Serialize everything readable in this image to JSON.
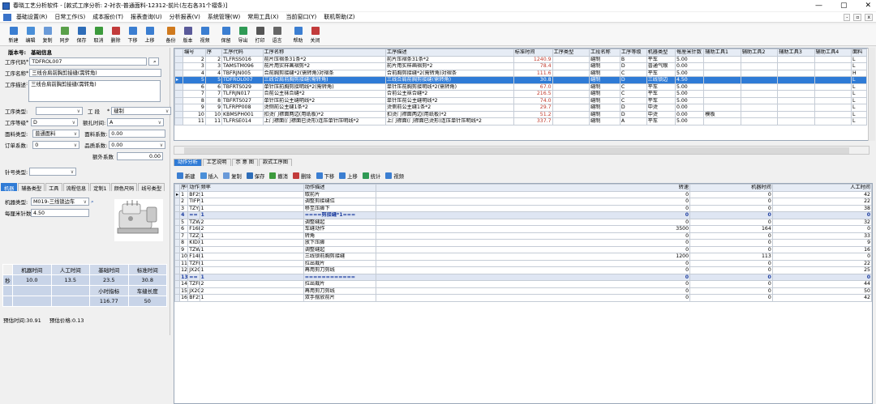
{
  "window": {
    "title": "春晓工艺分析软件 - [款式工序分析: 2-衬衣-普通面料-12312-前片(左右各31个褶条)]"
  },
  "menu": [
    "基础设置(R)",
    "日常工作(S)",
    "成本报价(T)",
    "报表查询(U)",
    "分析报表(V)",
    "系统管理(W)",
    "常用工具(X)",
    "当前窗口(Y)",
    "联机帮助(Z)"
  ],
  "toolbar": [
    {
      "label": "新建",
      "color": "#3b7ed1"
    },
    {
      "label": "编辑",
      "color": "#4a8fd8"
    },
    {
      "label": "复制",
      "color": "#6a9ad8"
    },
    {
      "label": "同步",
      "color": "#5aa04a"
    },
    {
      "label": "保存",
      "color": "#2e6db8"
    },
    {
      "label": "取消",
      "color": "#3c9a3c"
    },
    {
      "label": "删除",
      "color": "#c23b3b"
    },
    {
      "label": "下移",
      "color": "#3b7ed1"
    },
    {
      "label": "上移",
      "color": "#3b7ed1"
    },
    {
      "label": "备份",
      "color": "#d07a1e"
    },
    {
      "label": "版本",
      "color": "#5a5a9a"
    },
    {
      "label": "视频",
      "color": "#3b7ed1"
    },
    {
      "label": "保留",
      "color": "#3b7ed1"
    },
    {
      "label": "导出",
      "color": "#2f9a55"
    },
    {
      "label": "打印",
      "color": "#555555"
    },
    {
      "label": "语言",
      "color": "#666666"
    },
    {
      "label": "帮助",
      "color": "#3b7ed1"
    },
    {
      "label": "关闭",
      "color": "#c23b3b"
    }
  ],
  "left": {
    "version_label": "版本号:",
    "basic_info_label": "基础信息",
    "code_label": "工序代码",
    "code_value": "TDFROL007",
    "name_label": "工序名称",
    "name_value": "三线合肩前胸剪接缝(需转角)",
    "desc_label": "工序描述",
    "desc_value": "三线合肩前胸剪接缝(需转角)",
    "type_label": "工序类型:",
    "type_value": "",
    "section_label": "工  段",
    "section_value": "缝制",
    "grade_label": "工序等级",
    "grade_value": "D",
    "shortening_label": "额扎时间:",
    "shortening_value": "A",
    "fabric_label": "面料类型:",
    "fabric_value": "普通面料",
    "fabric_coef_label": "面料系数:",
    "fabric_coef_value": "0.00",
    "order_label": "订单系数:",
    "order_value": "0",
    "quality_label": "品质系数:",
    "quality_value": "0.00",
    "extra_label": "额外系数",
    "extra_value": "0.00",
    "needle_label": "针号类型:",
    "needle_value": ""
  },
  "lower_tabs": [
    "机器",
    "辅备类型",
    "工具",
    "流程信息",
    "定制1",
    "颜色尺码",
    "线号类型"
  ],
  "machine": {
    "type_label": "机器类型:",
    "type_value": "M019-三线锁边车",
    "stitch_label": "每厘米针数",
    "stitch_value": "4.50"
  },
  "stats": {
    "h1": "机器时间",
    "h2": "人工时间",
    "h3": "基础时间",
    "h4": "标准时间",
    "unit": "秒",
    "v1": "10.0",
    "v2": "13.5",
    "v3": "23.5",
    "v4": "30.8",
    "h5": "小时指标",
    "h6": "车缝长度",
    "v5": "116.77",
    "v6": "50"
  },
  "footer": {
    "time": "预估时间:30.91",
    "price": "预估价格:0.13"
  },
  "grid1": {
    "headers": [
      "编号",
      "序",
      "工序代码",
      "工序名称",
      "工序描述",
      "标准时间",
      "工序类型",
      "工段名称",
      "工序等级",
      "机器类型",
      "每厘米针数",
      "辅助工具1",
      "辅助工具2",
      "辅助工具3",
      "辅助工具4",
      "面料"
    ],
    "rows": [
      [
        "2",
        "2",
        "TLFRSS016",
        "前片压褶条31条*2",
        "前片压褶条31条*2",
        "1240.9",
        "",
        "缝制",
        "B",
        "平车",
        "5.00",
        "",
        "",
        "",
        "",
        "L"
      ],
      [
        "3",
        "3",
        "TAMSTM096",
        "前片用实样画褶剪*2",
        "前片用实样画褶剪*2",
        "78.4",
        "",
        "缝制",
        "D",
        "普通气眼",
        "0.00",
        "",
        "",
        "",
        "",
        "L"
      ],
      [
        "4",
        "4",
        "TBFRJN005",
        "合前胸剪接缝*2(需转角)对褶条",
        "合前胸剪接缝*2(需转角)对褶条",
        "111.6",
        "",
        "缝制",
        "C",
        "平车",
        "5.00",
        "",
        "",
        "",
        "",
        "H"
      ],
      [
        "5",
        "5",
        "TDFROL007",
        "三线合肩前胸剪接缝(需转角)",
        "三线合肩前胸剪接缝(需转角)",
        "30.8",
        "",
        "缝制",
        "D",
        "三线锁边",
        "4.50",
        "",
        "",
        "",
        "",
        "L"
      ],
      [
        "6",
        "6",
        "TBFRTS029",
        "单针压前胸剪接明线*2(需转角)",
        "单针压前胸剪接明线*2(需转角)",
        "67.0",
        "",
        "缝制",
        "C",
        "平车",
        "5.00",
        "",
        "",
        "",
        "",
        "L"
      ],
      [
        "7",
        "7",
        "TLFRJN017",
        "合前公主袜合缝*2",
        "合前公主袜合缝*2",
        "216.5",
        "",
        "缝制",
        "C",
        "平车",
        "5.00",
        "",
        "",
        "",
        "",
        "L"
      ],
      [
        "8",
        "8",
        "TBFRTS027",
        "单针压前公主缝明线*2",
        "单针压前公主缝明线*2",
        "74.0",
        "",
        "缝制",
        "C",
        "平车",
        "5.00",
        "",
        "",
        "",
        "",
        "L"
      ],
      [
        "9",
        "9",
        "TLFRPP008",
        "烫侧前公主缝1条*2",
        "烫侧前公主缝1条*2",
        "29.7",
        "",
        "缝制",
        "D",
        "中烫",
        "0.00",
        "",
        "",
        "",
        "",
        "L"
      ],
      [
        "10",
        "10",
        "KBMSPH001",
        "扣烫门襟面两边(用纸板)*2",
        "扣烫门襟面两边(用纸板)*2",
        "51.2",
        "",
        "缝制",
        "D",
        "中烫",
        "0.00",
        "模板",
        "",
        "",
        "",
        "L"
      ],
      [
        "11",
        "11",
        "TLFRSE014",
        "上门襟面(门襟面已烫形)连压单针压明线*2",
        "上门襟面(门襟面已烫形)连压单针压明线*2",
        "337.7",
        "",
        "缝制",
        "A",
        "平车",
        "5.00",
        "",
        "",
        "",
        "",
        "L"
      ]
    ]
  },
  "panel_tabs": [
    "动作分析",
    "工艺说明",
    "示 意 图",
    "款式工序图"
  ],
  "panel_toolbar": [
    {
      "label": "新建",
      "color": "#3b7ed1"
    },
    {
      "label": "插入",
      "color": "#4a8fd8"
    },
    {
      "label": "复制",
      "color": "#6a9ad8"
    },
    {
      "label": "保存",
      "color": "#2e6db8"
    },
    {
      "label": "撤消",
      "color": "#3c9a3c"
    },
    {
      "label": "删除",
      "color": "#c23b3b"
    },
    {
      "label": "下移",
      "color": "#3b7ed1"
    },
    {
      "label": "上移",
      "color": "#3b7ed1"
    },
    {
      "label": "统计",
      "color": "#2f9a55"
    },
    {
      "label": "视频",
      "color": "#3b7ed1"
    }
  ],
  "grid2": {
    "headers": [
      "序号",
      "动作代码",
      "频率",
      "动作描述",
      "转速",
      "机器时间",
      "人工时间"
    ],
    "rows": [
      [
        "1",
        "BF2S",
        "1",
        "取前片",
        "0",
        "0",
        "42"
      ],
      [
        "2",
        "TIFP",
        "1",
        "调整剪接缝位",
        "0",
        "0",
        "22"
      ],
      [
        "3",
        "TZYJ",
        "1",
        "移至压脚下",
        "0",
        "0",
        "38"
      ],
      [
        "4",
        "==",
        "1",
        "====剪接缝*1===",
        "0",
        "0",
        "0"
      ],
      [
        "5",
        "TZWQ",
        "2",
        "调整缝起",
        "0",
        "0",
        "32"
      ],
      [
        "6",
        "F16LC",
        "2",
        "车缝动作",
        "3500",
        "164",
        "0"
      ],
      [
        "7",
        "TZZJ",
        "1",
        "转角",
        "0",
        "0",
        "33"
      ],
      [
        "8",
        "KIDX",
        "1",
        "放下压脚",
        "0",
        "0",
        "9"
      ],
      [
        "9",
        "TZWQ",
        "1",
        "调整缝起",
        "0",
        "0",
        "16"
      ],
      [
        "10",
        "F14LA",
        "1",
        "三线锁前胸剪接缝",
        "1200",
        "113",
        "0"
      ],
      [
        "11",
        "TZFP",
        "1",
        "拉出裁片",
        "0",
        "0",
        "22"
      ],
      [
        "12",
        "JX2C",
        "1",
        "再用剪刀剪线",
        "0",
        "0",
        "25"
      ],
      [
        "13",
        "==",
        "1",
        "============",
        "0",
        "0",
        "0"
      ],
      [
        "14",
        "TZFP",
        "2",
        "拉出裁片",
        "0",
        "0",
        "44"
      ],
      [
        "15",
        "JX2C",
        "2",
        "再用剪刀剪线",
        "0",
        "0",
        "50"
      ],
      [
        "16",
        "BF2S",
        "1",
        "双手摆放前片",
        "0",
        "0",
        "42"
      ]
    ]
  }
}
